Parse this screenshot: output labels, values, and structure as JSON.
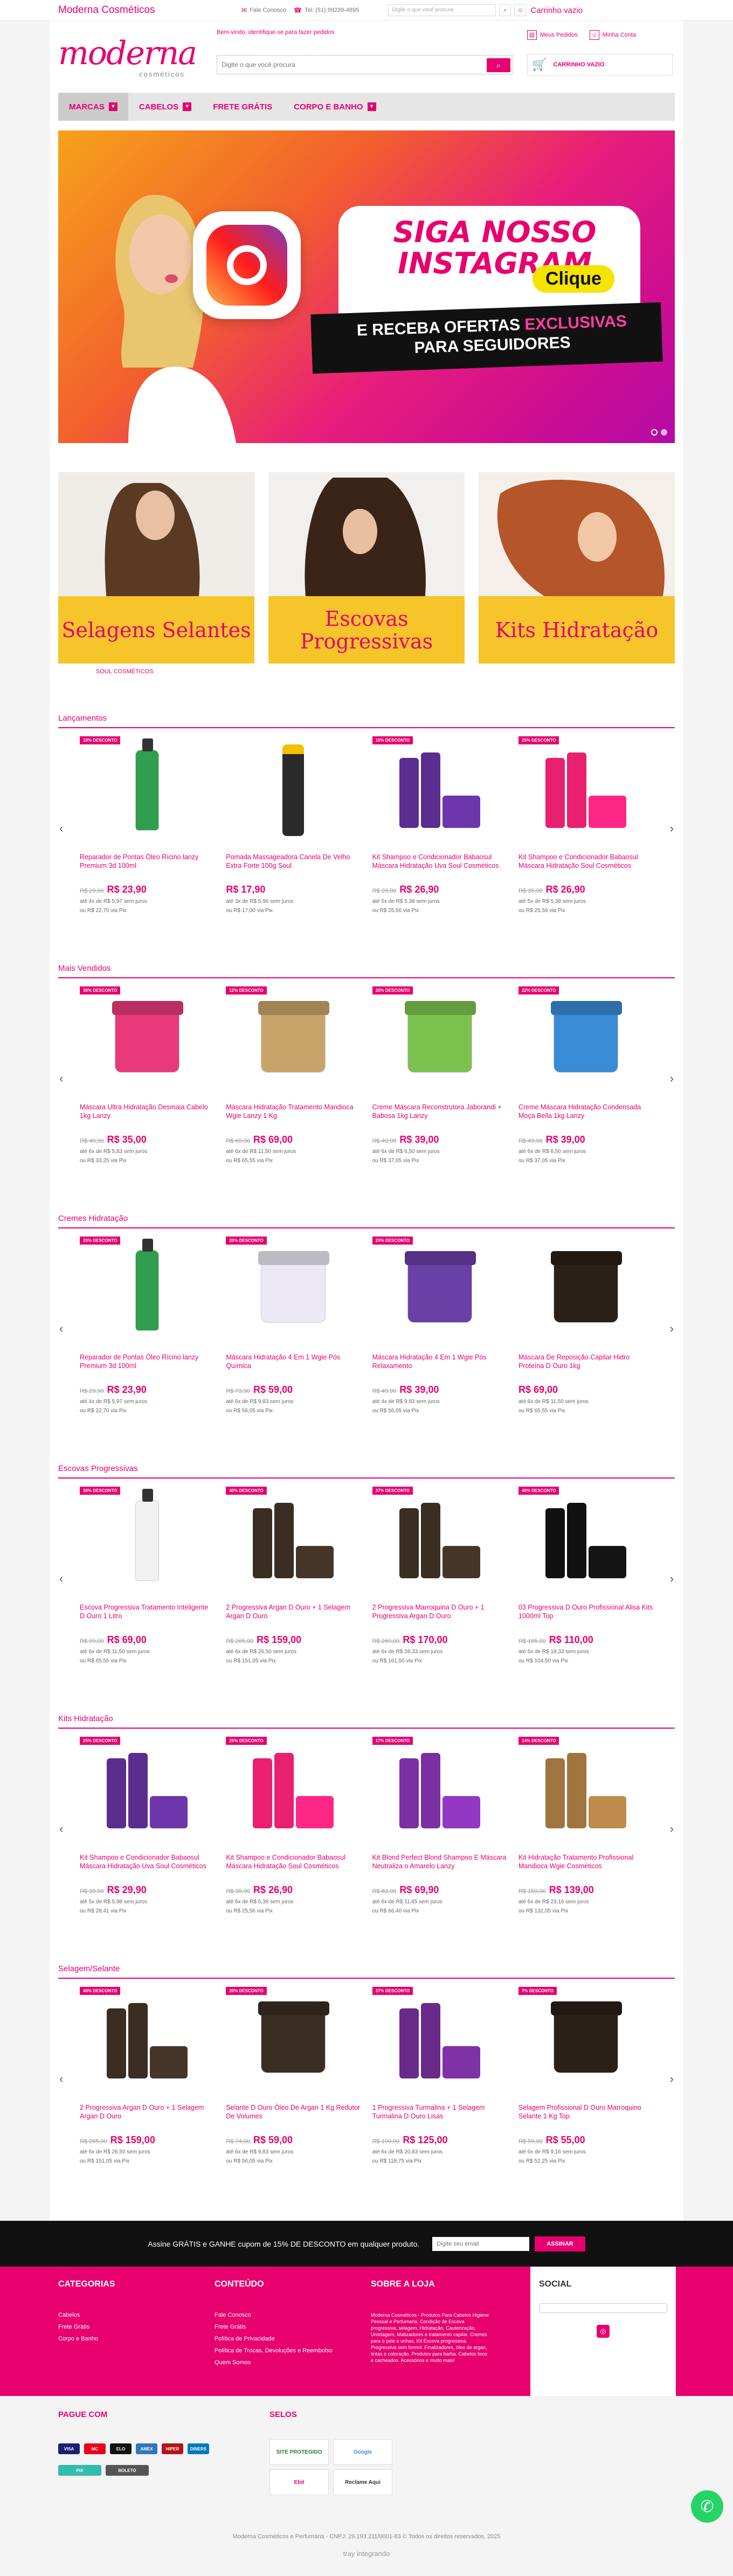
{
  "topbar": {
    "brand": "Moderna Cosméticos",
    "contact": "Fale Conosco",
    "phone": "Tel: (51) 99239-4895",
    "search_placeholder": "Digite o que você procura",
    "cart_label": "Carrinho vazio"
  },
  "header": {
    "logo": "moderna",
    "logo_sub": "cosméticos",
    "welcome": "Bem-vindo, identifique-se para fazer pedidos",
    "search_placeholder": "Digite o que você procura",
    "my_orders": "Meus Pedidos",
    "my_account": "Minha Conta",
    "cart": "CARRINHO VAZIO"
  },
  "nav": [
    {
      "label": "MARCAS",
      "dropdown": true
    },
    {
      "label": "CABELOS",
      "dropdown": true
    },
    {
      "label": "FRETE GRÁTIS",
      "dropdown": false
    },
    {
      "label": "CORPO E BANHO",
      "dropdown": true
    }
  ],
  "banner": {
    "title": "SIGA NOSSO INSTAGRAM",
    "cta": "Clique",
    "subtitle_pre": "E RECEBA OFERTAS",
    "subtitle_em": "EXCLUSIVAS",
    "subtitle_post": "PARA SEGUIDORES"
  },
  "categories": [
    {
      "label": "Selagens Selantes"
    },
    {
      "label": "Escovas Progressivas"
    },
    {
      "label": "Kits Hidratação"
    }
  ],
  "brand_link": "SOUL COSMÉTICOS",
  "sections": [
    {
      "title": "Lançamentos",
      "products": [
        {
          "badge": "18% DESCONTO",
          "name": "Reparador de Pontas Óleo Rícino lanzy Premium 3d 100ml",
          "old": "R$ 29,90",
          "price": "R$ 23,90",
          "inst": "até 4x de R$ 5,97 sem juros",
          "pix": "ou R$ 22,70 via Pix",
          "kind": "bottle",
          "color": "#2f9e4f"
        },
        {
          "badge": "",
          "name": "Pomada Massageadora Canela De Velho Extra Forte 100g Soul",
          "old": "",
          "price": "R$ 17,90",
          "inst": "até 3x de R$ 5,96 sem juros",
          "pix": "ou R$ 17,00 via Pix",
          "kind": "tube",
          "color": "#2a2a2a"
        },
        {
          "badge": "10% DESCONTO",
          "name": "Kit Shampoo e Condicionador Babaosul Máscara Hidratação Uva Soul Cosméticos",
          "old": "R$ 29,90",
          "price": "R$ 26,90",
          "inst": "até 5x de R$ 5,38 sem juros",
          "pix": "ou R$ 25,56 via Pix",
          "kind": "set",
          "color": "#5b2d8e"
        },
        {
          "badge": "25% DESCONTO",
          "name": "Kit Shampoo e Condicionador Babaosul Máscara Hidratação Soul Cosméticos",
          "old": "R$ 35,90",
          "price": "R$ 26,90",
          "inst": "até 5x de R$ 5,38 sem juros",
          "pix": "ou R$ 25,56 via Pix",
          "kind": "set",
          "color": "#e8206f"
        }
      ]
    },
    {
      "title": "Mais Vendidos",
      "products": [
        {
          "badge": "30% DESCONTO",
          "name": "Máscara Ultra Hidratação Desmaia Cabelo 1kg Lanzy",
          "old": "R$ 49,90",
          "price": "R$ 35,00",
          "inst": "até 6x de R$ 5,83 sem juros",
          "pix": "ou R$ 33,25 via Pix",
          "kind": "jar",
          "color": "#e83a7a"
        },
        {
          "badge": "12% DESCONTO",
          "name": "Máscara Hidratação Tratamento Mandioca Wgie Lanzy 1 Kg",
          "old": "R$ 69,00",
          "price": "R$ 69,00",
          "inst": "até 6x de R$ 11,50 sem juros",
          "pix": "ou R$ 65,55 via Pix",
          "kind": "jar",
          "color": "#c9a46a"
        },
        {
          "badge": "20% DESCONTO",
          "name": "Creme Máscara Reconstrutora Jaborandi + Babosa 1kg Lanzy",
          "old": "R$ 49,90",
          "price": "R$ 39,00",
          "inst": "até 6x de R$ 6,50 sem juros",
          "pix": "ou R$ 37,05 via Pix",
          "kind": "jar",
          "color": "#7cc24e"
        },
        {
          "badge": "22% DESCONTO",
          "name": "Creme Máscara Hidratação Condensada Moça Bella 1kg Lanzy",
          "old": "R$ 49,90",
          "price": "R$ 39,00",
          "inst": "até 6x de R$ 6,50 sem juros",
          "pix": "ou R$ 37,05 via Pix",
          "kind": "jar",
          "color": "#3a8bd6"
        }
      ]
    },
    {
      "title": "Cremes Hidratação",
      "products": [
        {
          "badge": "20% DESCONTO",
          "name": "Reparador de Pontas Óleo Rícino lanzy Premium 3d 100ml",
          "old": "R$ 29,90",
          "price": "R$ 23,90",
          "inst": "até 4x de R$ 5,97 sem juros",
          "pix": "ou R$ 22,70 via Pix",
          "kind": "bottle",
          "color": "#2f9e4f"
        },
        {
          "badge": "20% DESCONTO",
          "name": "Máscara Hidratação 4 Em 1 Wgie Pós Química",
          "old": "R$ 73,90",
          "price": "R$ 59,00",
          "inst": "até 6x de R$ 9,83 sem juros",
          "pix": "ou R$ 56,05 via Pix",
          "kind": "jar",
          "color": "#ece9f5"
        },
        {
          "badge": "20% DESCONTO",
          "name": "Máscara Hidratação 4 Em 1 Wgie Pós Relaxamento",
          "old": "R$ 49,90",
          "price": "R$ 39,00",
          "inst": "até 4x de R$ 9,83 sem juros",
          "pix": "ou R$ 56,05 via Pix",
          "kind": "jar",
          "color": "#6a3fa6"
        },
        {
          "badge": "",
          "name": "Máscara De Reposição Capilar Hidro Proteína D Ouro 1kg",
          "old": "",
          "price": "R$ 69,00",
          "inst": "até 6x de R$ 11,50 sem juros",
          "pix": "ou R$ 65,55 via Pix",
          "kind": "jar",
          "color": "#2a2017"
        }
      ]
    },
    {
      "title": "Escovas Progressivas",
      "products": [
        {
          "badge": "30% DESCONTO",
          "name": "Escova Progressiva Tratamento Inteligente D Ouro 1 Litro",
          "old": "R$ 99,00",
          "price": "R$ 69,00",
          "inst": "até 6x de R$ 11,50 sem juros",
          "pix": "ou R$ 65,55 via Pix",
          "kind": "bottle",
          "color": "#f2f2f2"
        },
        {
          "badge": "40% DESCONTO",
          "name": "2 Progressiva Argan D Ouro + 1 Selagem Argan D Ouro",
          "old": "R$ 265,00",
          "price": "R$ 159,00",
          "inst": "até 6x de R$ 26,50 sem juros",
          "pix": "ou R$ 151,05 via Pix",
          "kind": "set",
          "color": "#3a2d22"
        },
        {
          "badge": "37% DESCONTO",
          "name": "2 Progressiva Marroquina D Ouro + 1 Progressiva Argan D Ouro",
          "old": "R$ 269,00",
          "price": "R$ 170,00",
          "inst": "até 6x de R$ 28,33 sem juros",
          "pix": "ou R$ 161,50 via Pix",
          "kind": "set",
          "color": "#3a2d22"
        },
        {
          "badge": "40% DESCONTO",
          "name": "03 Progressiva D Ouro Profissional Alisa Kits 1000ml Top",
          "old": "R$ 185,00",
          "price": "R$ 110,00",
          "inst": "até 6x de R$ 18,33 sem juros",
          "pix": "ou R$ 104,50 via Pix",
          "kind": "set",
          "color": "#111111"
        }
      ]
    },
    {
      "title": "Kits Hidratação",
      "products": [
        {
          "badge": "25% DESCONTO",
          "name": "Kit Shampoo e Condicionador Babaosul Máscara Hidratação Uva Soul Cosméticos",
          "old": "R$ 39,90",
          "price": "R$ 29,90",
          "inst": "até 5x de R$ 5,98 sem juros",
          "pix": "ou R$ 28,41 via Pix",
          "kind": "set",
          "color": "#5b2d8e"
        },
        {
          "badge": "25% DESCONTO",
          "name": "Kit Shampoo e Condicionador Babaosul Máscara Hidratação Soul Cosméticos",
          "old": "R$ 35,90",
          "price": "R$ 26,90",
          "inst": "até 5x de R$ 5,38 sem juros",
          "pix": "ou R$ 25,56 via Pix",
          "kind": "set",
          "color": "#e8206f"
        },
        {
          "badge": "17% DESCONTO",
          "name": "Kit Blond Perfect Blond Shampoo E Máscara Neutraliza o Amarelo Lanzy",
          "old": "R$ 83,90",
          "price": "R$ 69,90",
          "inst": "até 6x de R$ 11,65 sem juros",
          "pix": "ou R$ 66,40 via Pix",
          "kind": "set",
          "color": "#7a2fa3"
        },
        {
          "badge": "14% DESCONTO",
          "name": "Kit Hidratação Tratamento Profissional Mandioca Wgie Cosméticos",
          "old": "R$ 159,00",
          "price": "R$ 139,00",
          "inst": "até 6x de R$ 23,16 sem juros",
          "pix": "ou R$ 132,05 via Pix",
          "kind": "set",
          "color": "#a0743f"
        }
      ]
    },
    {
      "title": "Selagem/Selante",
      "products": [
        {
          "badge": "40% DESCONTO",
          "name": "2 Progressiva Argan D Ouro + 1 Selagem Argan D Ouro",
          "old": "R$ 265,00",
          "price": "R$ 159,00",
          "inst": "até 6x de R$ 26,50 sem juros",
          "pix": "ou R$ 151,05 via Pix",
          "kind": "set",
          "color": "#3a2d22"
        },
        {
          "badge": "20% DESCONTO",
          "name": "Selante D Ouro Óleo De Argan 1 Kg Redutor De Volumes",
          "old": "R$ 74,00",
          "price": "R$ 59,00",
          "inst": "até 6x de R$ 9,83 sem juros",
          "pix": "ou R$ 56,05 via Pix",
          "kind": "jar",
          "color": "#3a2d22"
        },
        {
          "badge": "37% DESCONTO",
          "name": "1 Progressiva Turmalina + 1 Selagem Turmalina D Ouro Lisas",
          "old": "R$ 199,00",
          "price": "R$ 125,00",
          "inst": "até 6x de R$ 20,83 sem juros",
          "pix": "ou R$ 118,75 via Pix",
          "kind": "set",
          "color": "#6a2a8a"
        },
        {
          "badge": "7% DESCONTO",
          "name": "Selagem Profissional D Ouro Marroquino Selante 1 Kg Top",
          "old": "R$ 59,00",
          "price": "R$ 55,00",
          "inst": "até 6x de R$ 9,16 sem juros",
          "pix": "ou R$ 52,25 via Pix",
          "kind": "jar",
          "color": "#2a2017"
        }
      ]
    }
  ],
  "newsletter": {
    "text": "Assine GRÁTIS e GANHE cupom de 15% DE DESCONTO em qualquer produto.",
    "placeholder": "Digite seu email",
    "button": "ASSINAR"
  },
  "footer": {
    "categories_title": "CATEGORIAS",
    "categories": [
      "Cabelos",
      "Frete Grátis",
      "Corpo e Banho"
    ],
    "content_title": "CONTEÚDO",
    "content": [
      "Fale Conosco",
      "Frete Grátis",
      "Política de Privacidade",
      "Política de Trocas, Devoluções e Reembolso",
      "Quem Somos"
    ],
    "about_title": "SOBRE A LOJA",
    "about": "Moderna Cosméticos - Produtos Para Cabelos Higiene Pessoal e Perfumaria. Condição de Escova progressiva, selagem, Hidratação, Cauterização, Umidagem, Matizadores e tratamento capilar. Cremes para o pele e unhas. Kit Escova progressiva. Progressiva sem formol. Finalizadores, óleo de argan, tintas e coloração. Produtos para barba. Cabelos lisos e cacheados. Acessórios e muito mais!",
    "social_title": "SOCIAL"
  },
  "payments": {
    "title": "PAGUE COM",
    "methods": [
      "VISA",
      "MC",
      "ELO",
      "AMEX",
      "HIPER",
      "DINERS",
      "PIX",
      "BOLETO"
    ]
  },
  "seals": {
    "title": "SELOS",
    "items": [
      "SITE PROTEGIDO",
      "Google",
      "Ebit",
      "Reclame Aqui"
    ]
  },
  "copyright": "Moderna Cosméticos e Perfumaria - CNPJ: 29.193.211/0001-83 © Todos os direitos reservados. 2025",
  "powered": "tray integrando"
}
